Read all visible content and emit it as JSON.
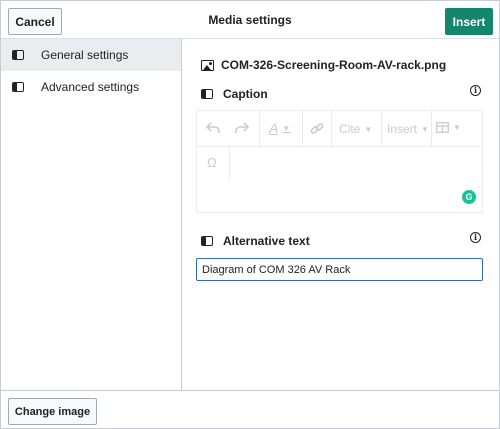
{
  "header": {
    "cancel_label": "Cancel",
    "title": "Media settings",
    "insert_label": "Insert"
  },
  "sidebar": {
    "items": [
      {
        "label": "General settings",
        "active": true,
        "icon": "panel-icon"
      },
      {
        "label": "Advanced settings",
        "active": false,
        "icon": "panel-icon"
      }
    ]
  },
  "main": {
    "filename": "COM-326-Screening-Room-AV-rack.png",
    "caption": {
      "title": "Caption",
      "info_symbol": "i",
      "toolbar": {
        "undo_icon": "undo-icon",
        "redo_icon": "redo-icon",
        "text_style_symbol": "A",
        "link_icon": "link-icon",
        "cite_label": "Cite",
        "insert_label": "Insert",
        "table_icon": "table-icon",
        "special_char_symbol": "Ω"
      }
    },
    "grammarly_symbol": "G",
    "alt_text": {
      "title": "Alternative text",
      "info_symbol": "i",
      "value": "Diagram of COM 326 AV Rack"
    }
  },
  "footer": {
    "change_image_label": "Change image"
  },
  "colors": {
    "accent": "#14866d",
    "focus_border": "#3366cc",
    "grammarly": "#15c39a",
    "sidebar_active": "#eaecf0"
  }
}
